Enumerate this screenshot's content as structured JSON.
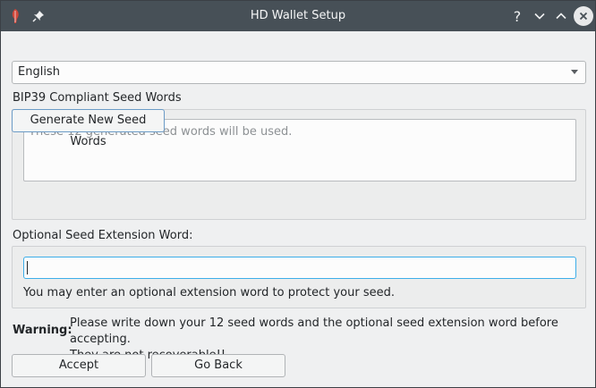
{
  "window": {
    "title": "HD Wallet Setup",
    "icons": {
      "app": "feather-app-icon",
      "pin": "pin-icon",
      "help": "question-icon",
      "minimize": "chevron-down-icon",
      "maximize": "chevron-up-icon",
      "close": "close-icon"
    },
    "help_glyph": "?"
  },
  "language": {
    "selected": "English"
  },
  "seed": {
    "label": "BIP39 Compliant Seed Words",
    "placeholder": "These 12 generated seed words will be used.",
    "generate_label": "Generate New Seed Words"
  },
  "extension": {
    "label": "Optional Seed Extension Word:",
    "value": "",
    "hint": "You may enter an optional extension word to protect your seed."
  },
  "warning": {
    "label": "Warning:",
    "line1": "Please write down your 12 seed words and the optional seed extension word before accepting.",
    "line2": "They are not recoverable!!"
  },
  "actions": {
    "accept_label": "Accept",
    "back_label": "Go Back"
  },
  "colors": {
    "titlebar": "#475057",
    "focus": "#3daee9",
    "app_icon": "#d0473a"
  }
}
